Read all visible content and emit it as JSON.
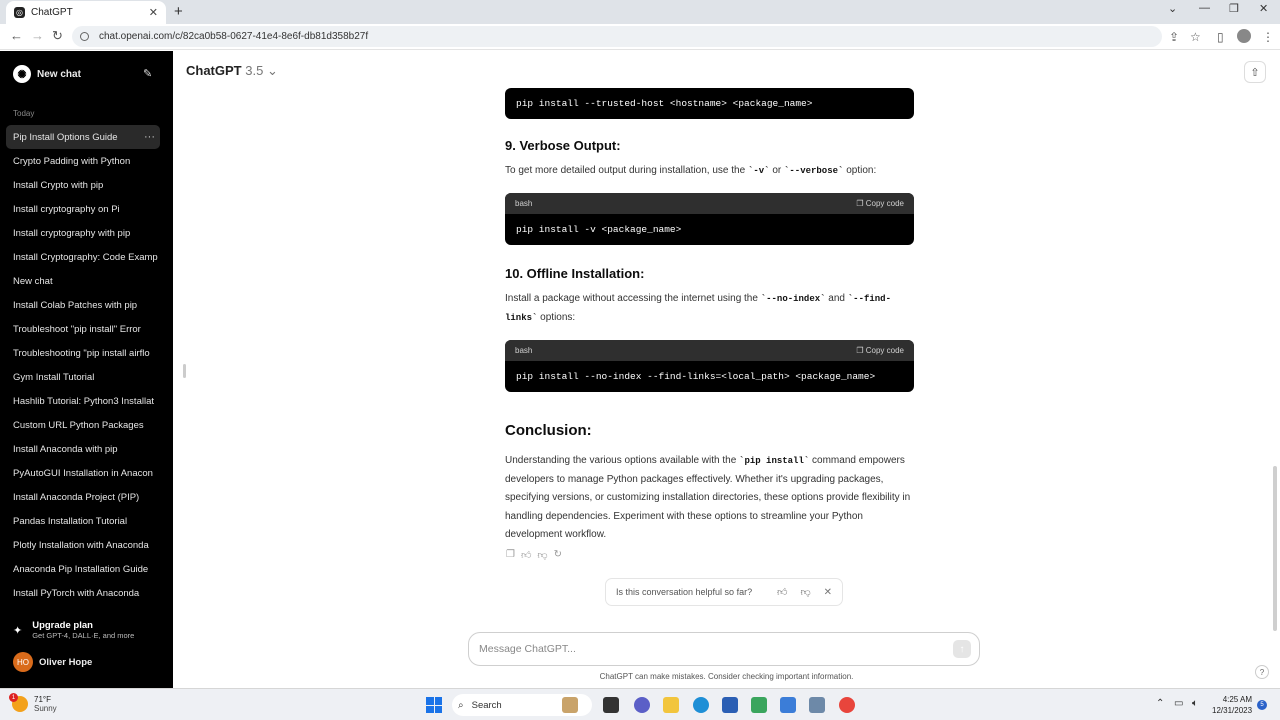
{
  "browser": {
    "tab_title": "ChatGPT",
    "url": "chat.openai.com/c/82ca0b58-0627-41e4-8e6f-db81d358b27f"
  },
  "sidebar": {
    "new_chat": "New chat",
    "section": "Today",
    "items": [
      "Pip Install Options Guide",
      "Crypto Padding with Python",
      "Install Crypto with pip",
      "Install cryptography on Pi",
      "Install cryptography with pip",
      "Install Cryptography: Code Examp",
      "New chat",
      "Install Colab Patches with pip",
      "Troubleshoot \"pip install\" Error",
      "Troubleshooting \"pip install airflo",
      "Gym Install Tutorial",
      "Hashlib Tutorial: Python3 Installat",
      "Custom URL Python Packages",
      "Install Anaconda with pip",
      "PyAutoGUI Installation in Anacon",
      "Install Anaconda Project (PIP)",
      "Pandas Installation Tutorial",
      "Plotly Installation with Anaconda",
      "Anaconda Pip Installation Guide",
      "Install PyTorch with Anaconda"
    ],
    "upgrade_title": "Upgrade plan",
    "upgrade_sub": "Get GPT-4, DALL·E, and more",
    "user_initials": "HO",
    "user_name": "Oliver Hope"
  },
  "header": {
    "model": "ChatGPT",
    "version": "3.5"
  },
  "content": {
    "code1": "pip install --trusted-host <hostname> <package_name>",
    "h9": "9. Verbose Output:",
    "p9_a": "To get more detailed output during installation, use the ",
    "p9_c1": "`-v`",
    "p9_b": " or ",
    "p9_c2": "`--verbose`",
    "p9_d": " option:",
    "lang": "bash",
    "copy": "Copy code",
    "code2": "pip install -v <package_name>",
    "h10": "10. Offline Installation:",
    "p10_a": "Install a package without accessing the internet using the ",
    "p10_c1": "`--no-index`",
    "p10_b": " and ",
    "p10_c2": "`--find-links`",
    "p10_d": " options:",
    "code3": "pip install --no-index --find-links=<local_path> <package_name>",
    "conclusion": "Conclusion:",
    "pc_a": "Understanding the various options available with the ",
    "pc_c": "`pip install`",
    "pc_b": " command empowers developers to manage Python packages effectively. Whether it's upgrading packages, specifying versions, or customizing installation directories, these options provide flexibility in handling dependencies. Experiment with these options to streamline your Python development workflow."
  },
  "feedback": {
    "question": "Is this conversation helpful so far?"
  },
  "composer": {
    "placeholder": "Message ChatGPT...",
    "disclaimer": "ChatGPT can make mistakes. Consider checking important information."
  },
  "taskbar": {
    "temp": "71°F",
    "condition": "Sunny",
    "weather_badge": "1",
    "search": "Search",
    "time": "4:25 AM",
    "date": "12/31/2023",
    "notif": "5"
  }
}
